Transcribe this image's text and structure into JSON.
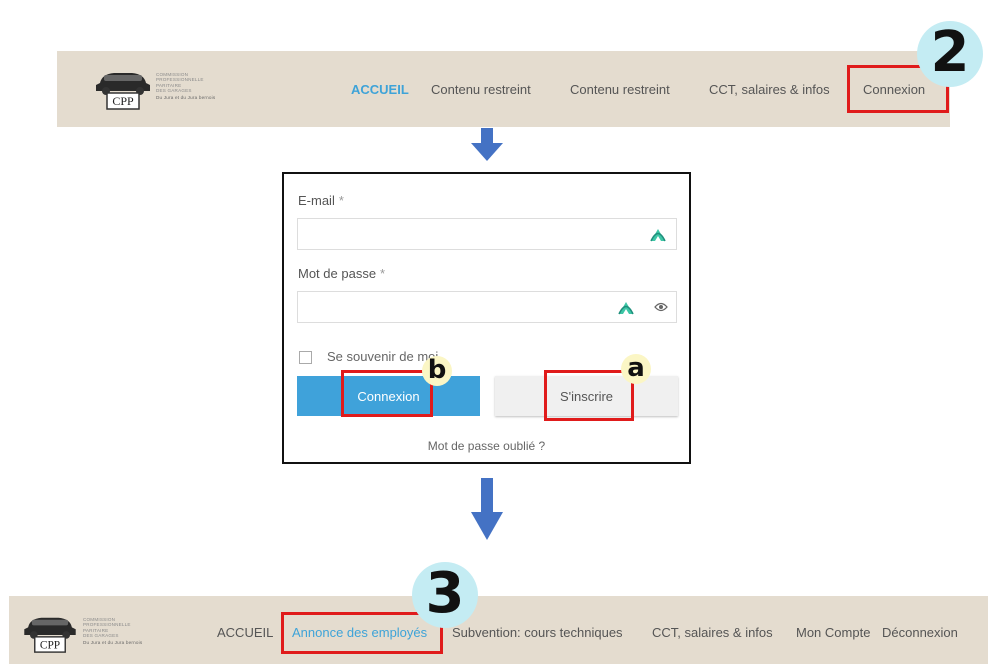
{
  "logo": {
    "initials": "CPP",
    "lines": [
      "COMMISSION",
      "PROFESSIONNELLE",
      "PARITAIRE",
      "DES GARAGES"
    ],
    "tagline": "Du Jura et du Jura bernois"
  },
  "step2_header": {
    "badge": "2",
    "menu": [
      "ACCUEIL",
      "Contenu restreint",
      "Contenu restreint",
      "CCT, salaires & infos",
      "Connexion"
    ]
  },
  "login_form": {
    "email_label": "E-mail",
    "password_label": "Mot de passe",
    "required_mark": "*",
    "remember_label": "Se souvenir de moi",
    "login_button": "Connexion",
    "signup_button": "S'inscrire",
    "forgot_link": "Mot de passe oublié ?",
    "badge_login": "b",
    "badge_signup": "a"
  },
  "step3_header": {
    "badge": "3",
    "menu": [
      "ACCUEIL",
      "Annonce des employés",
      "Subvention: cours techniques",
      "CCT, salaires & infos",
      "Mon Compte",
      "Déconnexion"
    ]
  },
  "colors": {
    "nav_bg": "#e4dccf",
    "accent": "#3ea3d8",
    "highlight": "#e01b1b",
    "badge_big": "#c4ecf3",
    "badge_small": "#fbf6c5",
    "arrow": "#4472c4",
    "login_button": "#3fa2da"
  }
}
